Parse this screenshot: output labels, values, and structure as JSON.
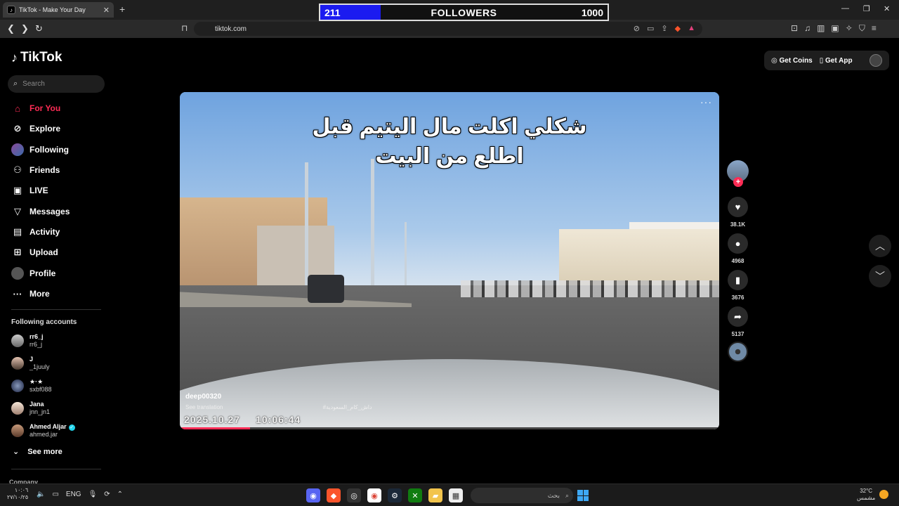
{
  "browser": {
    "tab_title": "TikTok - Make Your Day",
    "url": "tiktok.com",
    "new_tab": "+",
    "tab_close": "✕"
  },
  "overlay": {
    "current": "211",
    "label": "FOLLOWERS",
    "goal": "1000",
    "progress_fraction": 0.211,
    "fill_color": "#1b1bf0"
  },
  "sidebar": {
    "logo": "TikTok",
    "search_placeholder": "Search",
    "nav": [
      {
        "label": "For You",
        "icon": "home-icon"
      },
      {
        "label": "Explore",
        "icon": "compass-icon"
      },
      {
        "label": "Following",
        "icon": "avatar-icon"
      },
      {
        "label": "Friends",
        "icon": "friends-icon"
      },
      {
        "label": "LIVE",
        "icon": "live-icon"
      },
      {
        "label": "Messages",
        "icon": "messages-icon"
      },
      {
        "label": "Activity",
        "icon": "activity-icon"
      },
      {
        "label": "Upload",
        "icon": "upload-icon"
      },
      {
        "label": "Profile",
        "icon": "profile-icon"
      },
      {
        "label": "More",
        "icon": "more-icon"
      }
    ],
    "following_title": "Following accounts",
    "accounts": [
      {
        "name": "rr6_j",
        "handle": "rr6_j"
      },
      {
        "name": "J",
        "handle": "_1juuly"
      },
      {
        "name": "★·★",
        "handle": "sxbf088"
      },
      {
        "name": "Jana",
        "handle": "jnn_jn1"
      },
      {
        "name": "Ahmed Aljar",
        "handle": "ahmed.jar",
        "verified": true
      }
    ],
    "see_more": "See more",
    "company": "Company"
  },
  "topbar": {
    "get_coins": "Get Coins",
    "get_app": "Get App"
  },
  "video": {
    "caption_line1": "شكلي اكلت مال اليتيم قبل",
    "caption_line2": "اطلع من البيت",
    "author": "deep00320",
    "description": "See translation",
    "hashtag": "#داش_كام_السعودية",
    "stamp_date": "2025.10.27",
    "stamp_time": "10:06:44",
    "progress_fraction": 0.13,
    "more_dots": "···"
  },
  "actions": {
    "likes": "38.1K",
    "comments": "4968",
    "saves": "3676",
    "shares": "5137",
    "follow_plus": "+"
  },
  "taskbar": {
    "clock_time": "١٠:٠٦",
    "clock_date": "٢٧/١٠/٢٥",
    "language": "ENG",
    "search_text": "بحث",
    "temperature": "32°C",
    "weather": "مشمس"
  },
  "colors": {
    "accent": "#fe2c55",
    "verified": "#20d5ec"
  }
}
